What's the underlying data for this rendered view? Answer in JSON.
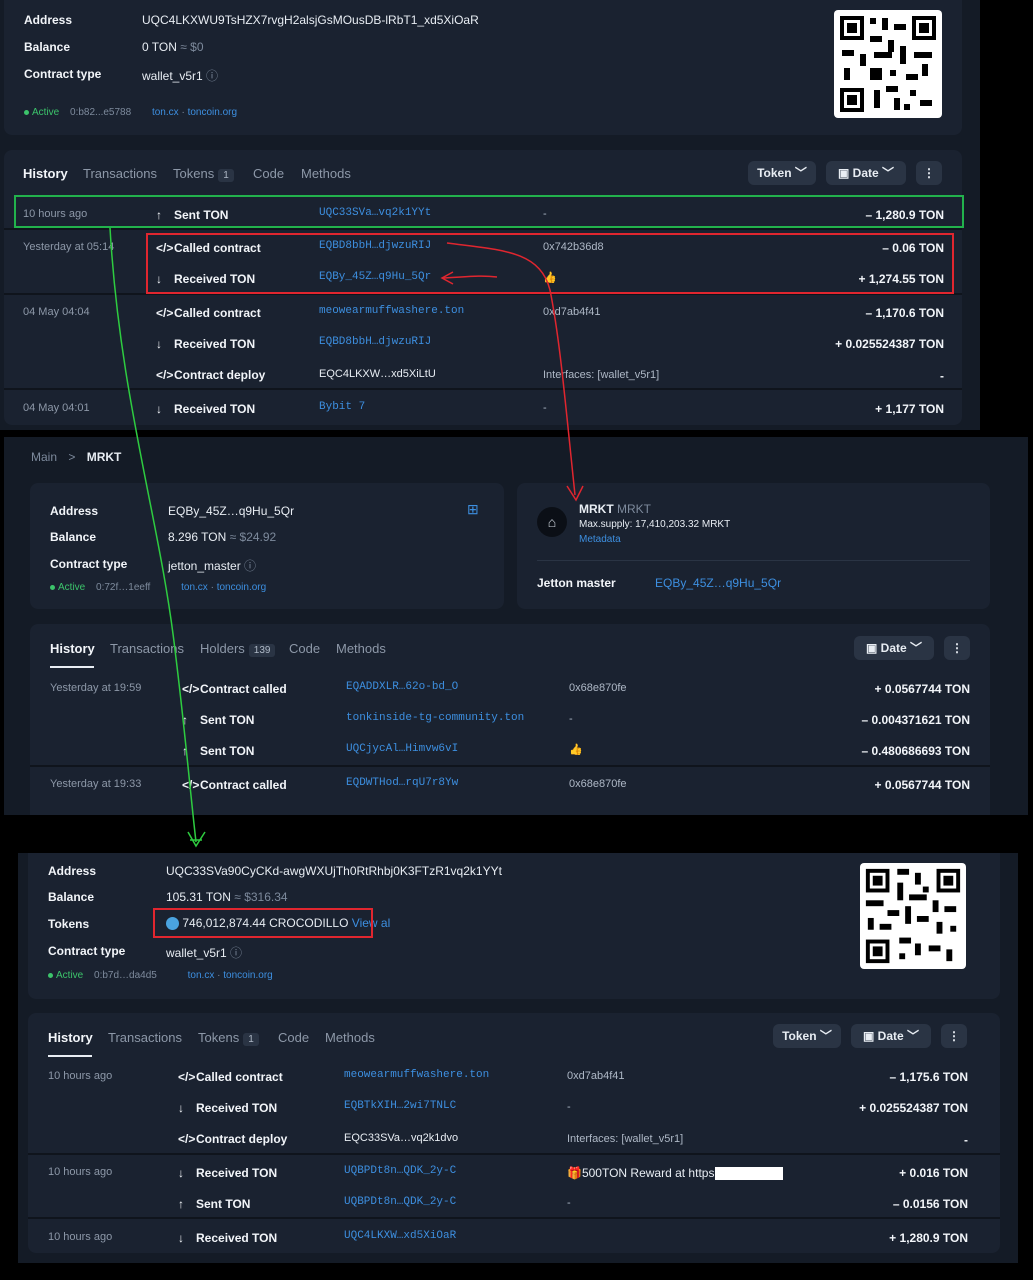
{
  "top": {
    "info": {
      "address_label": "Address",
      "address": "UQC4LKXWU9TsHZX7rvgH2alsjGsMOusDB-lRbT1_xd5XiOaR",
      "balance_label": "Balance",
      "balance": "0 TON",
      "balance_usd": "≈ $0",
      "contract_label": "Contract type",
      "contract": "wallet_v5r1",
      "status": "Active",
      "hash": "0:b82...e5788",
      "link1": "ton.cx",
      "dotsep": "·",
      "link2": "toncoin.org"
    },
    "tabs": [
      {
        "label": "History"
      },
      {
        "label": "Transactions"
      },
      {
        "label": "Tokens",
        "badge": "1"
      },
      {
        "label": "Code"
      },
      {
        "label": "Methods"
      }
    ],
    "filters": {
      "token": "Token",
      "date": "Date",
      "more": "⋮"
    },
    "rows": [
      {
        "time": "10 hours ago",
        "icon": "↑",
        "action": "Sent TON",
        "addr": "UQC33SVa…vq2k1YYt",
        "mid": "-",
        "amount": "– 1,280.9 TON"
      },
      {
        "time": "Yesterday at 05:14",
        "icon": "</>",
        "action": "Called contract",
        "addr": "EQBD8bbH…djwzuRIJ",
        "mid": "0x742b36d8",
        "amount": "– 0.06 TON"
      },
      {
        "time": "",
        "icon": "↓",
        "action": "Received TON",
        "addr": "EQBy_45Z…q9Hu_5Qr",
        "mid": "👍",
        "amount": "+ 1,274.55 TON"
      },
      {
        "time": "04 May 04:04",
        "icon": "</>",
        "action": "Called contract",
        "addr": "meowearmuffwashere.ton",
        "mid": "0xd7ab4f41",
        "amount": "– 1,170.6 TON"
      },
      {
        "time": "",
        "icon": "↓",
        "action": "Received TON",
        "addr": "EQBD8bbH…djwzuRIJ",
        "mid": "",
        "amount": "+ 0.025524387 TON"
      },
      {
        "time": "",
        "icon": "</>",
        "action": "Contract deploy",
        "addr": "EQC4LKXW…xd5XiLtU",
        "mid": "Interfaces: [wallet_v5r1]",
        "amount": "-"
      },
      {
        "time": "04 May 04:01",
        "icon": "↓",
        "action": "Received TON",
        "addr": "Bybit 7",
        "mid": "-",
        "amount": "+ 1,177 TON"
      }
    ]
  },
  "middle": {
    "breadcrumb": {
      "root": "Main",
      "sep": ">",
      "current": "MRKT"
    },
    "info": {
      "address_label": "Address",
      "address": "EQBy_45Z…q9Hu_5Qr",
      "balance_label": "Balance",
      "balance": "8.296 TON",
      "balance_usd": "≈ $24.92",
      "contract_label": "Contract type",
      "contract": "jetton_master",
      "status": "Active",
      "hash": "0:72f…1eeff",
      "link1": "ton.cx",
      "dotsep": "·",
      "link2": "toncoin.org"
    },
    "jetton": {
      "name": "MRKT",
      "ticker": "MRKT",
      "supply": "Max.supply: 17,410,203.32 MRKT",
      "metadata": "Metadata",
      "master_label": "Jetton master",
      "master": "EQBy_45Z…q9Hu_5Qr"
    },
    "tabs": [
      {
        "label": "History"
      },
      {
        "label": "Transactions"
      },
      {
        "label": "Holders",
        "badge": "139"
      },
      {
        "label": "Code"
      },
      {
        "label": "Methods"
      }
    ],
    "filters": {
      "date": "Date",
      "more": "⋮"
    },
    "rows": [
      {
        "time": "Yesterday at 19:59",
        "icon": "</>",
        "action": "Contract called",
        "addr": "EQADDXLR…62o-bd_O",
        "mid": "0x68e870fe",
        "amount": "+ 0.0567744 TON"
      },
      {
        "time": "",
        "icon": "↑",
        "action": "Sent TON",
        "addr": "tonkinside-tg-community.ton",
        "mid": "-",
        "amount": "– 0.004371621 TON"
      },
      {
        "time": "",
        "icon": "↑",
        "action": "Sent TON",
        "addr": "UQCjycAl…Himvw6vI",
        "mid": "👍",
        "amount": "– 0.480686693 TON"
      },
      {
        "time": "Yesterday at 19:33",
        "icon": "</>",
        "action": "Contract called",
        "addr": "EQDWTHod…rqU7r8Yw",
        "mid": "0x68e870fe",
        "amount": "+ 0.0567744 TON"
      }
    ]
  },
  "bottom": {
    "info": {
      "address_label": "Address",
      "address": "UQC33SVa90CyCKd-awgWXUjTh0RtRhbj0K3FTzR1vq2k1YYt",
      "balance_label": "Balance",
      "balance": "105.31 TON",
      "balance_usd": "≈ $316.34",
      "tokens_label": "Tokens",
      "tokens": "746,012,874.44 CROCODILLO",
      "view_all": "View al",
      "contract_label": "Contract type",
      "contract": "wallet_v5r1",
      "status": "Active",
      "hash": "0:b7d…da4d5",
      "link1": "ton.cx",
      "dotsep": "·",
      "link2": "toncoin.org"
    },
    "tabs": [
      {
        "label": "History"
      },
      {
        "label": "Transactions"
      },
      {
        "label": "Tokens",
        "badge": "1"
      },
      {
        "label": "Code"
      },
      {
        "label": "Methods"
      }
    ],
    "filters": {
      "token": "Token",
      "date": "Date",
      "more": "⋮"
    },
    "rows": [
      {
        "time": "10 hours ago",
        "icon": "</>",
        "action": "Called contract",
        "addr": "meowearmuffwashere.ton",
        "mid": "0xd7ab4f41",
        "amount": "– 1,175.6 TON"
      },
      {
        "time": "",
        "icon": "↓",
        "action": "Received TON",
        "addr": "EQBTkXIH…2wi7TNLC",
        "mid": "-",
        "amount": "+ 0.025524387 TON"
      },
      {
        "time": "",
        "icon": "</>",
        "action": "Contract deploy",
        "addr": "EQC33SVa…vq2k1dvo",
        "mid": "Interfaces: [wallet_v5r1]",
        "amount": "-"
      },
      {
        "time": "10 hours ago",
        "icon": "↓",
        "action": "Received TON",
        "addr": "UQBPDt8n…QDK_2y-C",
        "mid": "🎁500TON Reward at https",
        "amount": "+ 0.016 TON"
      },
      {
        "time": "",
        "icon": "↑",
        "action": "Sent TON",
        "addr": "UQBPDt8n…QDK_2y-C",
        "mid": "-",
        "amount": "– 0.0156 TON"
      },
      {
        "time": "10 hours ago",
        "icon": "↓",
        "action": "Received TON",
        "addr": "UQC4LKXW…xd5XiOaR",
        "mid": "",
        "amount": "+ 1,280.9 TON"
      }
    ]
  },
  "colors": {
    "green_box": "#22b24c",
    "red_box": "#e0262f",
    "arrow_green": "#2ecc40",
    "arrow_red": "#e0262f",
    "positive": "#3cc46b",
    "link": "#3d8fe0"
  }
}
